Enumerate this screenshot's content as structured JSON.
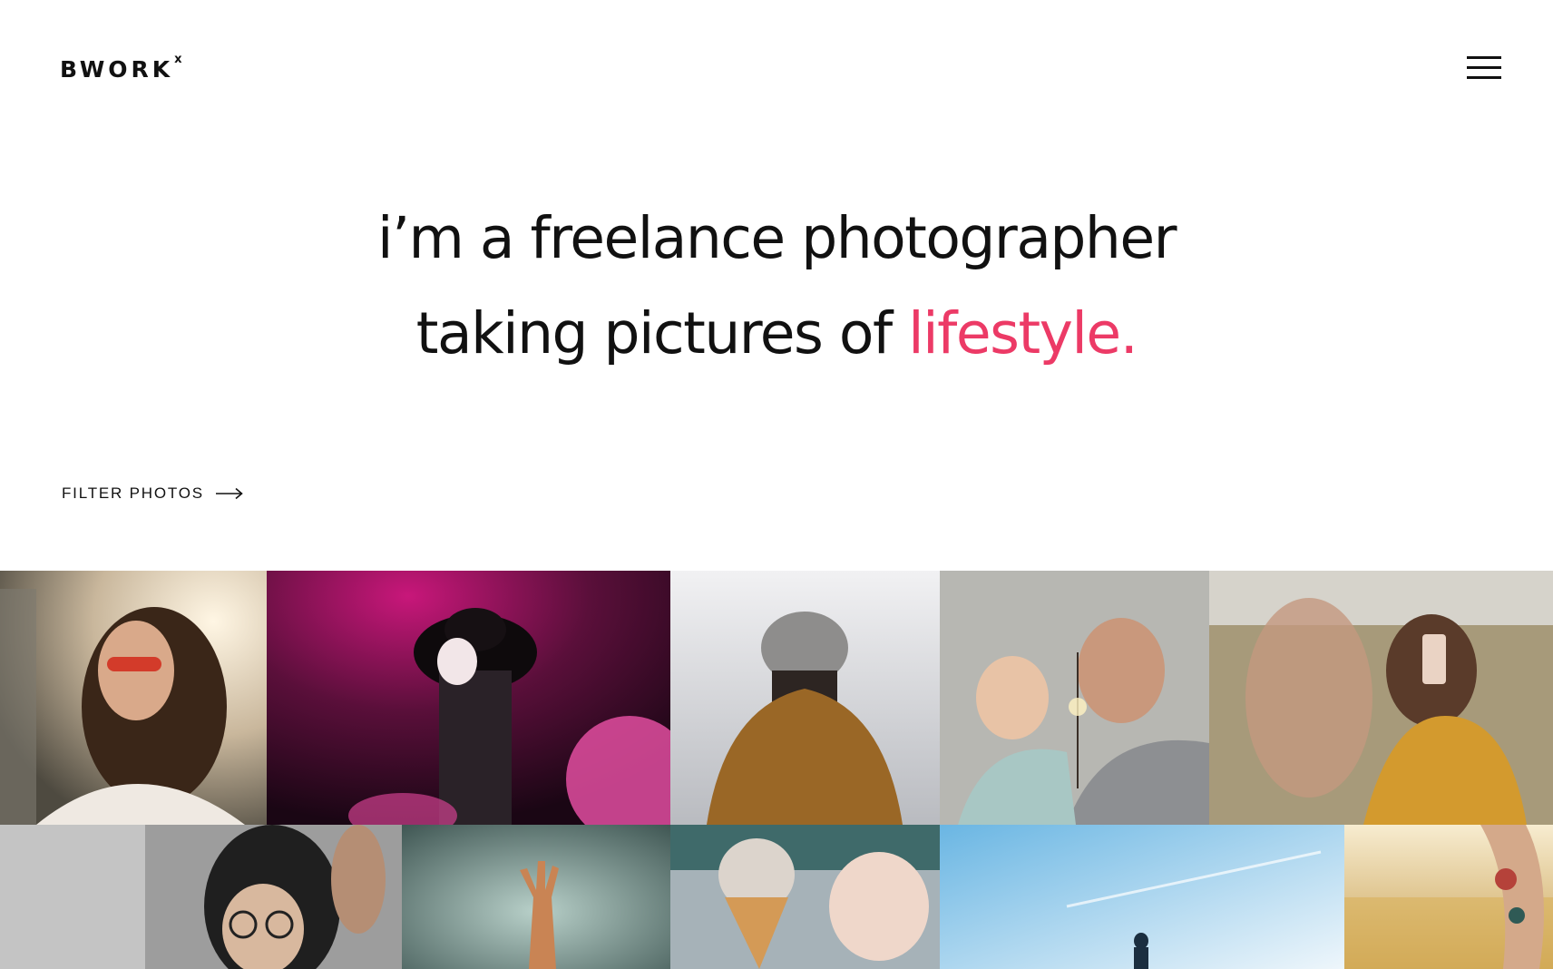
{
  "header": {
    "logo_text": "BWORK",
    "logo_mark": "x",
    "menu_icon": "hamburger-menu-icon"
  },
  "hero": {
    "line1": "i’m a freelance photographer",
    "line2_prefix": "taking pictures of ",
    "line2_accent": "lifestyle.",
    "accent_color": "#ec3a66"
  },
  "filter": {
    "label": "FILTER PHOTOS",
    "icon": "arrow-right-icon"
  },
  "gallery": {
    "photos": [
      "woman with red sunglasses smiling",
      "woman in hat with pink smoke",
      "person in beanie and brown hoodie",
      "man and child with sparkler",
      "woman in yellow sweater taking phone photo",
      "smiling woman with glasses",
      "hand reaching up in mist",
      "ice cream cone",
      "person walking under blue sky",
      "tattooed arm in golden field"
    ]
  },
  "colors": {
    "text": "#111111",
    "accent": "#ec3a66",
    "background": "#ffffff"
  }
}
